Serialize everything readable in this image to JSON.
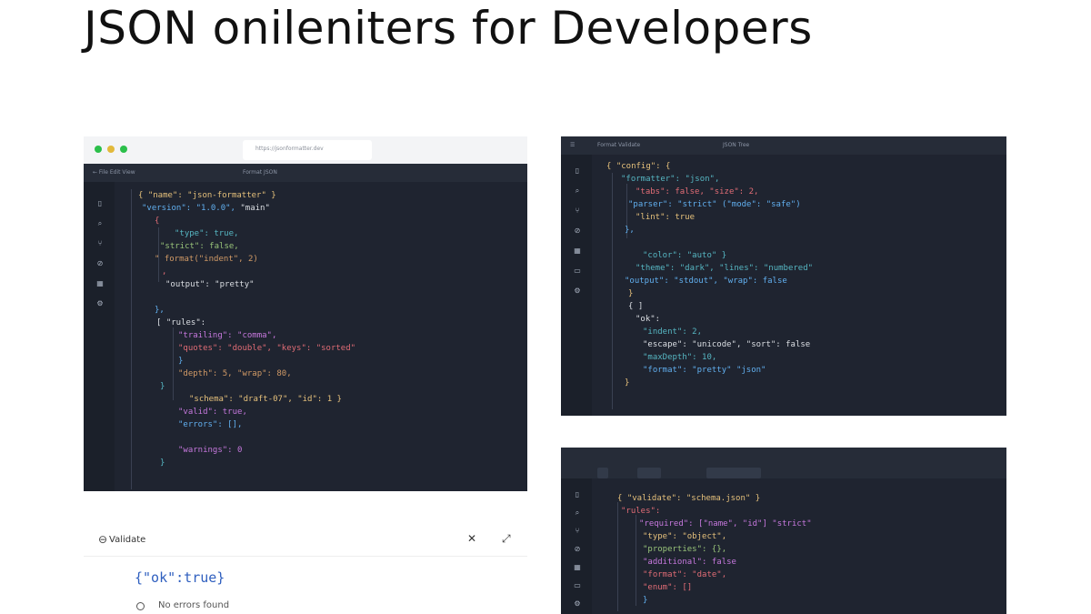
{
  "page": {
    "title": "JSON onileniters for Developers"
  },
  "colors": {
    "editor_bg": "#1f2430",
    "sidebar_bg": "#1b202a",
    "toolbar_bg": "#262c38",
    "token_yellow": "#e5c07b",
    "token_blue": "#61afef",
    "token_red": "#e06c75",
    "token_purple": "#c678dd",
    "token_cyan": "#56b6c2",
    "token_green": "#98c379",
    "token_orange": "#d19a66",
    "token_white": "#dcdfe4"
  },
  "window1": {
    "url": "https://jsonformatter.dev",
    "toolbar": [
      "← File  Edit  View",
      "Format  JSON"
    ],
    "sidebar_icons": [
      "file-icon",
      "search-icon",
      "git-icon",
      "debug-icon",
      "extensions-icon",
      "settings-icon"
    ]
  },
  "window2": {
    "toolbar": [
      "Format  Validate",
      "JSON  Tree"
    ],
    "sidebar_icons": [
      "file-icon",
      "search-icon",
      "git-icon",
      "debug-icon",
      "extensions-icon",
      "terminal-icon",
      "settings-icon"
    ]
  },
  "window3": {
    "sidebar_icons": [
      "file-icon",
      "search-icon",
      "git-icon",
      "debug-icon",
      "extensions-icon",
      "terminal-icon",
      "settings-icon"
    ]
  },
  "panel": {
    "title": "Validate",
    "value": "{\"ok\":true}",
    "item": "No errors found"
  },
  "code1": [
    {
      "indent": 60,
      "tokens": [
        {
          "t": "{ \"name\": \"json-formatter\" }",
          "c": "token_yellow"
        }
      ]
    },
    {
      "indent": 64,
      "tokens": [
        {
          "t": "\"version\": \"1.0.0\",",
          "c": "token_blue"
        },
        {
          "t": " \"main\"",
          "c": "token_white"
        }
      ]
    },
    {
      "indent": 78,
      "tokens": [
        {
          "t": "{",
          "c": "token_red"
        }
      ]
    },
    {
      "indent": 100,
      "tokens": [
        {
          "t": "\"type\": true,",
          "c": "token_cyan"
        }
      ]
    },
    {
      "indent": 84,
      "tokens": [
        {
          "t": "\"strict\": false,",
          "c": "token_green"
        }
      ]
    },
    {
      "indent": 78,
      "tokens": [
        {
          "t": "\" format(\"indent\", 2)",
          "c": "token_orange"
        }
      ]
    },
    {
      "indent": 86,
      "tokens": [
        {
          "t": ",",
          "c": "token_red"
        }
      ]
    },
    {
      "indent": 90,
      "tokens": [
        {
          "t": "\"output\": \"pretty\"",
          "c": "token_white"
        }
      ]
    },
    {
      "indent": 78,
      "tokens": [
        {
          "t": "",
          "c": "token_white"
        }
      ]
    },
    {
      "indent": 78,
      "tokens": [
        {
          "t": "},",
          "c": "token_blue"
        }
      ]
    },
    {
      "indent": 80,
      "tokens": [
        {
          "t": "[ \"rules\":",
          "c": "token_white"
        }
      ]
    },
    {
      "indent": 104,
      "tokens": [
        {
          "t": "\"trailing\": \"comma\",",
          "c": "token_purple"
        }
      ]
    },
    {
      "indent": 104,
      "tokens": [
        {
          "t": "\"quotes\": \"double\", \"keys\": \"sorted\"",
          "c": "token_red"
        }
      ]
    },
    {
      "indent": 104,
      "tokens": [
        {
          "t": "}",
          "c": "token_blue"
        }
      ]
    },
    {
      "indent": 104,
      "tokens": [
        {
          "t": "\"depth\": 5, \"wrap\": 80,",
          "c": "token_orange"
        }
      ]
    },
    {
      "indent": 84,
      "tokens": [
        {
          "t": "}",
          "c": "token_cyan"
        }
      ]
    },
    {
      "indent": 116,
      "tokens": [
        {
          "t": "\"schema\": \"draft-07\", \"id\": 1 }",
          "c": "token_yellow"
        }
      ]
    },
    {
      "indent": 104,
      "tokens": [
        {
          "t": "\"valid\": true,",
          "c": "token_purple"
        }
      ]
    },
    {
      "indent": 104,
      "tokens": [
        {
          "t": "\"errors\": [],",
          "c": "token_blue"
        }
      ]
    },
    {
      "indent": 104,
      "tokens": [
        {
          "t": "",
          "c": "token_white"
        }
      ]
    },
    {
      "indent": 104,
      "tokens": [
        {
          "t": "\"warnings\": 0",
          "c": "token_purple"
        }
      ]
    },
    {
      "indent": 84,
      "tokens": [
        {
          "t": "}",
          "c": "token_cyan"
        }
      ]
    }
  ],
  "code2": [
    {
      "indent": 50,
      "tokens": [
        {
          "t": "{ \"config\": {",
          "c": "token_yellow"
        }
      ]
    },
    {
      "indent": 66,
      "tokens": [
        {
          "t": "\"formatter\": \"json\",",
          "c": "token_cyan"
        }
      ]
    },
    {
      "indent": 82,
      "tokens": [
        {
          "t": "\"tabs\": false, \"size\": 2,",
          "c": "token_red"
        }
      ]
    },
    {
      "indent": 74,
      "tokens": [
        {
          "t": "\"parser\": \"strict\" (\"mode\": \"safe\")",
          "c": "token_blue"
        }
      ]
    },
    {
      "indent": 82,
      "tokens": [
        {
          "t": "\"lint\": true",
          "c": "token_yellow"
        }
      ]
    },
    {
      "indent": 70,
      "tokens": [
        {
          "t": "},",
          "c": "token_blue"
        }
      ]
    },
    {
      "indent": 70,
      "tokens": [
        {
          "t": "",
          "c": "token_white"
        }
      ]
    },
    {
      "indent": 90,
      "tokens": [
        {
          "t": "\"color\": \"auto\" }",
          "c": "token_cyan"
        }
      ]
    },
    {
      "indent": 82,
      "tokens": [
        {
          "t": "\"theme\": \"dark\", \"lines\": \"numbered\"",
          "c": "token_cyan"
        }
      ]
    },
    {
      "indent": 70,
      "tokens": [
        {
          "t": "\"output\": \"stdout\", \"wrap\": false",
          "c": "token_blue"
        }
      ]
    },
    {
      "indent": 74,
      "tokens": [
        {
          "t": "}",
          "c": "token_yellow"
        }
      ]
    },
    {
      "indent": 74,
      "tokens": [
        {
          "t": "{ ]",
          "c": "token_white"
        }
      ]
    },
    {
      "indent": 82,
      "tokens": [
        {
          "t": "\"ok\":",
          "c": "token_white"
        }
      ]
    },
    {
      "indent": 90,
      "tokens": [
        {
          "t": "\"indent\": 2,",
          "c": "token_cyan"
        }
      ]
    },
    {
      "indent": 90,
      "tokens": [
        {
          "t": "\"escape\": \"unicode\", \"sort\": false",
          "c": "token_white"
        }
      ]
    },
    {
      "indent": 90,
      "tokens": [
        {
          "t": "\"maxDepth\": 10,",
          "c": "token_cyan"
        }
      ]
    },
    {
      "indent": 90,
      "tokens": [
        {
          "t": "\"format\": \"pretty\" \"json\"",
          "c": "token_blue"
        }
      ]
    },
    {
      "indent": 70,
      "tokens": [
        {
          "t": "}",
          "c": "token_yellow"
        }
      ]
    }
  ],
  "code3": [
    {
      "indent": 62,
      "tokens": [
        {
          "t": "{ \"validate\": \"schema.json\" }",
          "c": "token_yellow"
        }
      ]
    },
    {
      "indent": 66,
      "tokens": [
        {
          "t": "\"rules\":",
          "c": "token_red"
        }
      ]
    },
    {
      "indent": 86,
      "tokens": [
        {
          "t": "\"required\": [\"name\", \"id\"] \"strict\"",
          "c": "token_purple"
        }
      ]
    },
    {
      "indent": 90,
      "tokens": [
        {
          "t": "\"type\": \"object\",",
          "c": "token_yellow"
        }
      ]
    },
    {
      "indent": 90,
      "tokens": [
        {
          "t": "\"properties\": {},",
          "c": "token_green"
        }
      ]
    },
    {
      "indent": 90,
      "tokens": [
        {
          "t": "\"additional\": false",
          "c": "token_purple"
        }
      ]
    },
    {
      "indent": 90,
      "tokens": [
        {
          "t": "\"format\": \"date\",",
          "c": "token_red"
        }
      ]
    },
    {
      "indent": 90,
      "tokens": [
        {
          "t": "\"enum\": []",
          "c": "token_red"
        }
      ]
    },
    {
      "indent": 90,
      "tokens": [
        {
          "t": "}",
          "c": "token_blue"
        }
      ]
    }
  ]
}
